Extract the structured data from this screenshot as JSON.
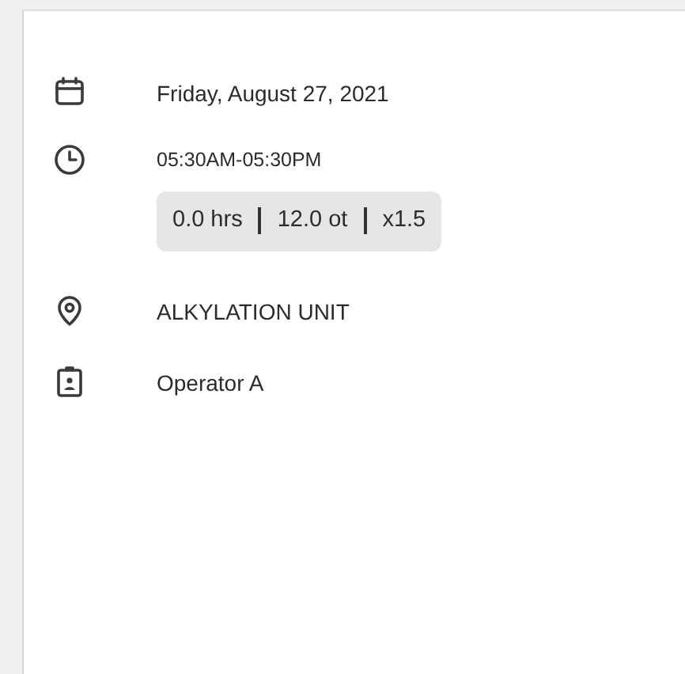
{
  "details": [
    {
      "kind": "date",
      "text": "Friday, August 27, 2021"
    },
    {
      "kind": "time",
      "text": "05:30AM-05:30PM",
      "stats": [
        "0.0 hrs",
        "12.0 ot",
        "x1.5"
      ]
    },
    {
      "kind": "location",
      "text": "ALKYLATION UNIT"
    },
    {
      "kind": "badge",
      "text": "Operator A"
    }
  ]
}
